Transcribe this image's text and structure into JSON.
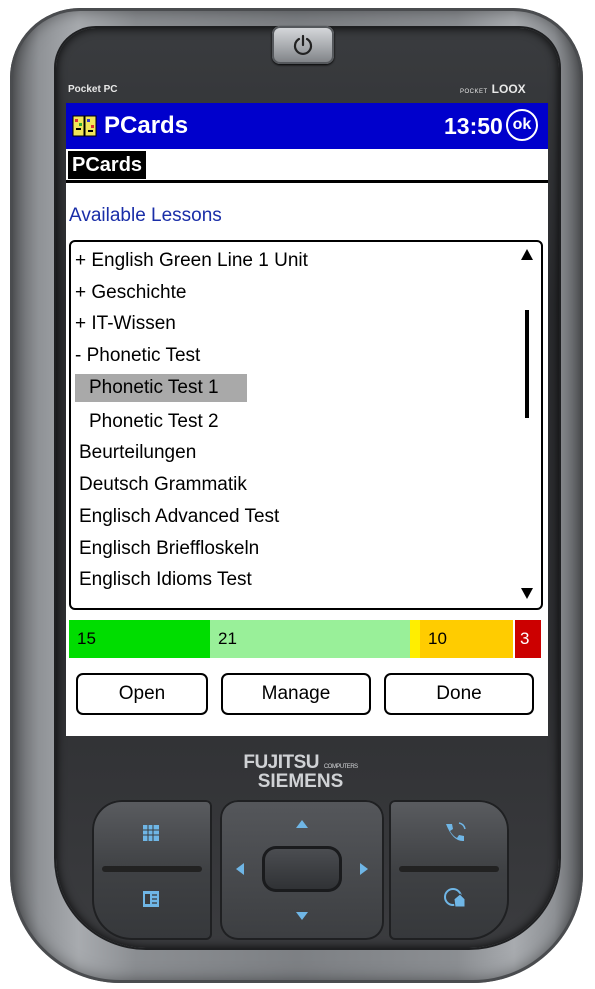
{
  "device": {
    "brand_left": "Pocket PC",
    "brand_right_small": "POCKET",
    "brand_right": "LOOX",
    "maker_line1": "FUJITSU",
    "maker_line1_small": "COMPUTERS",
    "maker_line2": "SIEMENS"
  },
  "titlebar": {
    "app_title": "PCards",
    "clock": "13:50",
    "ok_label": "ok"
  },
  "tabs": {
    "active": "PCards"
  },
  "section_title": "Available Lessons",
  "lessons": [
    {
      "label": "+ English Green Line 1 Unit",
      "selected": false
    },
    {
      "label": "+ Geschichte",
      "selected": false
    },
    {
      "label": "+ IT-Wissen",
      "selected": false
    },
    {
      "label": "- Phonetic Test",
      "selected": false
    },
    {
      "label": "Phonetic Test 1",
      "selected": true
    },
    {
      "label": "Phonetic Test 2",
      "selected": false
    },
    {
      "label": "Beurteilungen",
      "selected": false
    },
    {
      "label": "Deutsch Grammatik",
      "selected": false
    },
    {
      "label": "Englisch Advanced Test",
      "selected": false
    },
    {
      "label": "Englisch Brieffloskeln",
      "selected": false
    },
    {
      "label": "Englisch Idioms Test",
      "selected": false
    }
  ],
  "stats": [
    {
      "value": "15",
      "color": "#00dd00"
    },
    {
      "value": "21",
      "color": "#99f099"
    },
    {
      "value": "",
      "color": "#ffee00"
    },
    {
      "value": "10",
      "color": "#ffcc00"
    },
    {
      "value": "3",
      "color": "#cc0000"
    }
  ],
  "buttons": {
    "open": "Open",
    "manage": "Manage",
    "done": "Done"
  },
  "colors": {
    "titlebar_bg": "#0000cc",
    "section_title": "#1a2ea8",
    "selection": "#a9a9a9",
    "hw_icon": "#6fb6e6"
  },
  "icons": {
    "power": "power-icon",
    "app": "pcards-app-icon",
    "calendar": "calendar-icon",
    "contacts": "contacts-icon",
    "phone": "phone-icon",
    "home": "home-icon"
  }
}
